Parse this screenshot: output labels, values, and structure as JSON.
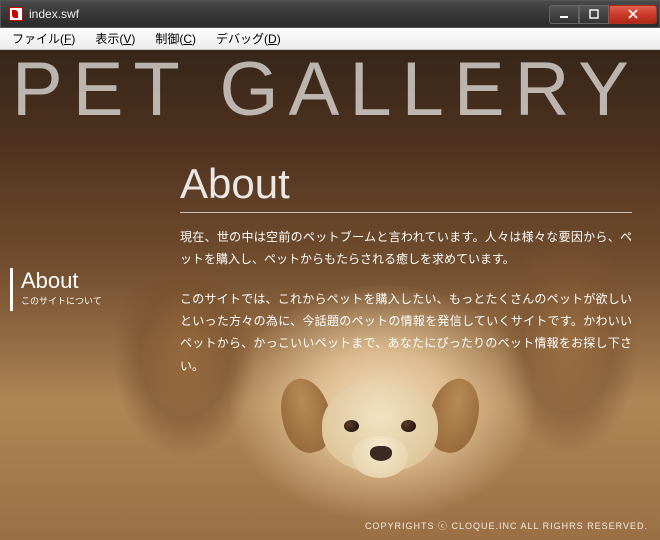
{
  "window": {
    "title": "index.swf"
  },
  "menu": {
    "file": "ファイル(",
    "file_u": "F",
    "file_end": ")",
    "view": "表示(",
    "view_u": "V",
    "view_end": ")",
    "control": "制御(",
    "control_u": "C",
    "control_end": ")",
    "debug": "デバッグ(",
    "debug_u": "D",
    "debug_end": ")"
  },
  "page": {
    "bigtitle": "PET GALLERY",
    "heading": "About",
    "p1": "現在、世の中は空前のペットブームと言われています。人々は様々な要因から、ペットを購入し、ペットからもたらされる癒しを求めています。",
    "p2": "このサイトでは、これからペットを購入したい、もっとたくさんのペットが欲しいといった方々の為に、今話題のペットの情報を発信していくサイトです。かわいいペットから、かっこいいペットまで、あなたにぴったりのペット情報をお探し下さい。",
    "sidebar_title": "About",
    "sidebar_sub": "このサイトについて",
    "footer": "COPYRIGHTS ⓒ CLOQUE.INC ALL RIGHRS RESERVED."
  }
}
